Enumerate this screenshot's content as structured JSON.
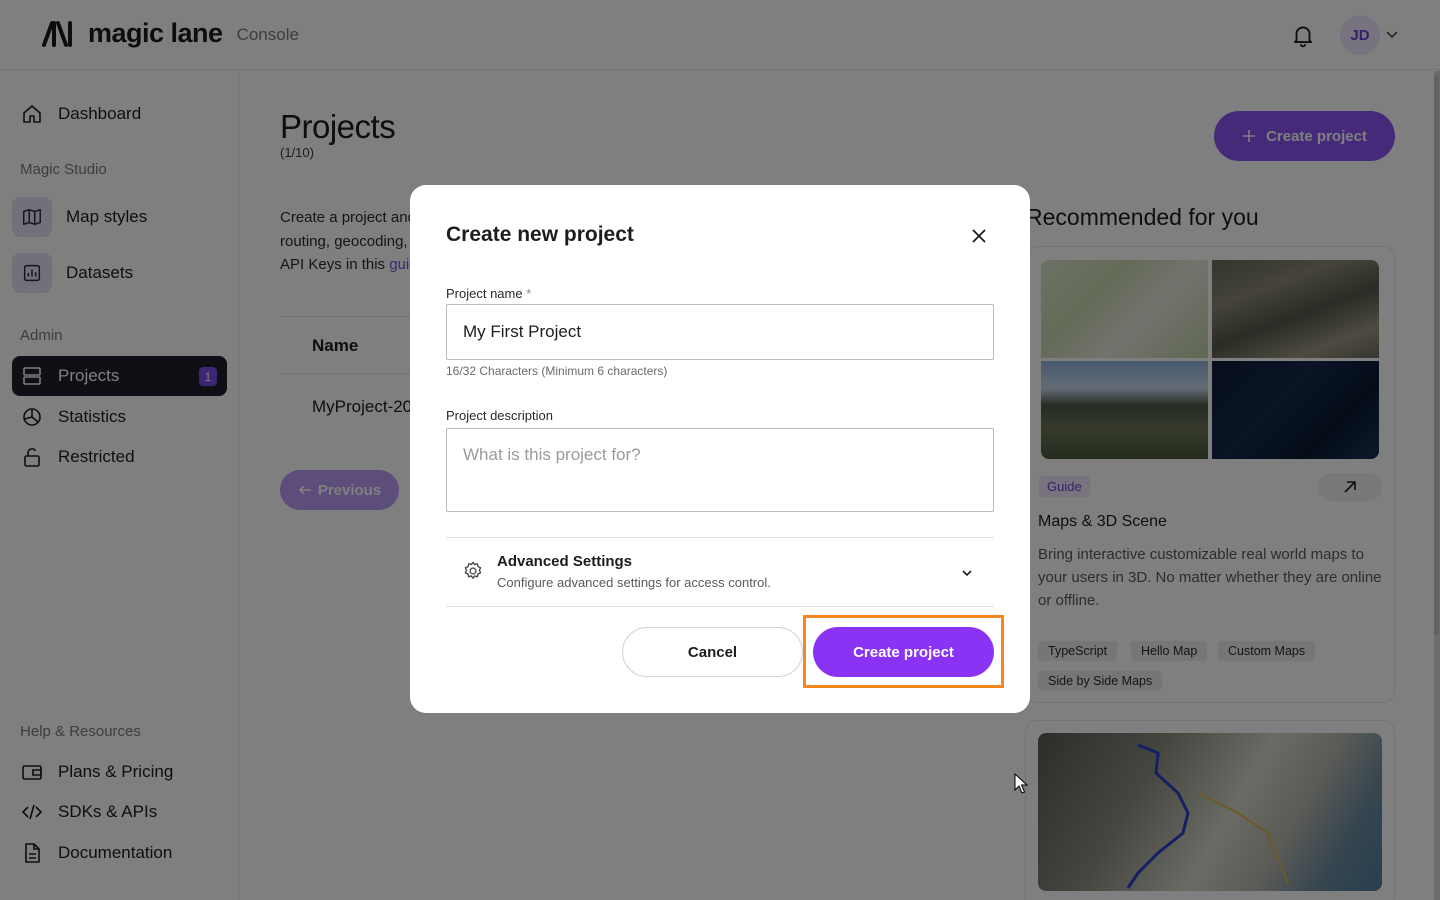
{
  "app": {
    "brand": "magic lane",
    "product": "Console",
    "user_initials": "JD"
  },
  "sidebar": {
    "items": [
      {
        "label": "Dashboard",
        "icon": "home-icon"
      },
      {
        "label": "Map styles",
        "icon": "map-icon"
      },
      {
        "label": "Datasets",
        "icon": "chart-icon"
      },
      {
        "label": "Projects",
        "icon": "layers-icon",
        "badge": "1",
        "active": true
      },
      {
        "label": "Statistics",
        "icon": "pie-chart-icon"
      },
      {
        "label": "Restricted",
        "icon": "lock-icon"
      },
      {
        "label": "Plans & Pricing",
        "icon": "wallet-icon"
      },
      {
        "label": "SDKs & APIs",
        "icon": "code-icon"
      },
      {
        "label": "Documentation",
        "icon": "document-icon"
      }
    ],
    "sections": {
      "magic_studio": "Magic Studio",
      "admin": "Admin",
      "help": "Help & Resources"
    }
  },
  "main": {
    "title": "Projects",
    "count": "(1/10)",
    "create_button": "Create project",
    "intro_line1": "Create a project and",
    "intro_line2": "routing, geocoding,",
    "intro_line3_pre": "API Keys in this ",
    "intro_link": "guid",
    "table_header_name": "Name",
    "row_name": "MyProject-20",
    "previous_button": "Previous"
  },
  "recommended": {
    "title": "Recommended for you",
    "card": {
      "tag": "Guide",
      "heading": "Maps & 3D Scene",
      "description": "Bring interactive customizable real world maps to your users in 3D. No matter whether they are online or offline.",
      "chips": [
        "TypeScript",
        "Hello Map",
        "Custom Maps",
        "Side by Side Maps"
      ]
    }
  },
  "modal": {
    "title": "Create new project",
    "name_label": "Project name",
    "required_mark": "*",
    "name_value": "My First Project",
    "name_hint": "16/32 Characters (Minimum 6 characters)",
    "description_label": "Project description",
    "description_placeholder": "What is this project for?",
    "advanced_title": "Advanced Settings",
    "advanced_subtitle": "Configure advanced settings for access control.",
    "cancel_label": "Cancel",
    "create_label": "Create project"
  },
  "colors": {
    "accent": "#8a33f5",
    "highlight": "#f7861e",
    "nav_active": "#1f1f2b"
  }
}
